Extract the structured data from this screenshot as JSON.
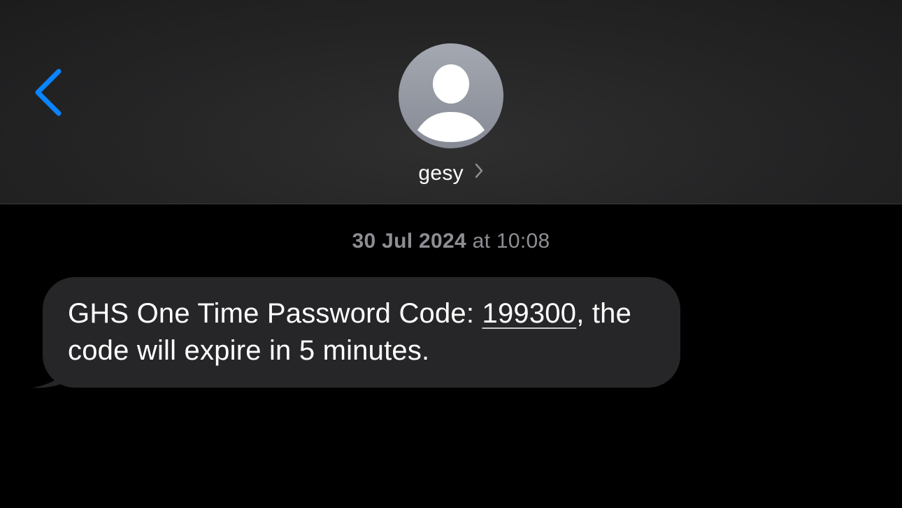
{
  "header": {
    "back_icon": "chevron-left-icon",
    "back_color": "#0a84ff",
    "contact": {
      "avatar_icon": "person-silhouette-icon",
      "name": "gesy",
      "chevron_icon": "chevron-right-icon"
    }
  },
  "conversation": {
    "timestamp": {
      "date": "30 Jul 2024",
      "at": " at ",
      "time": "10:08"
    },
    "messages": [
      {
        "direction": "incoming",
        "text_before": "GHS One Time Password Code: ",
        "code": "199300",
        "text_after": ", the code will expire in 5 minutes."
      }
    ]
  },
  "colors": {
    "background": "#000000",
    "incoming_bubble": "#262628",
    "timestamp_text": "#8d8d93",
    "accent": "#0a84ff"
  }
}
